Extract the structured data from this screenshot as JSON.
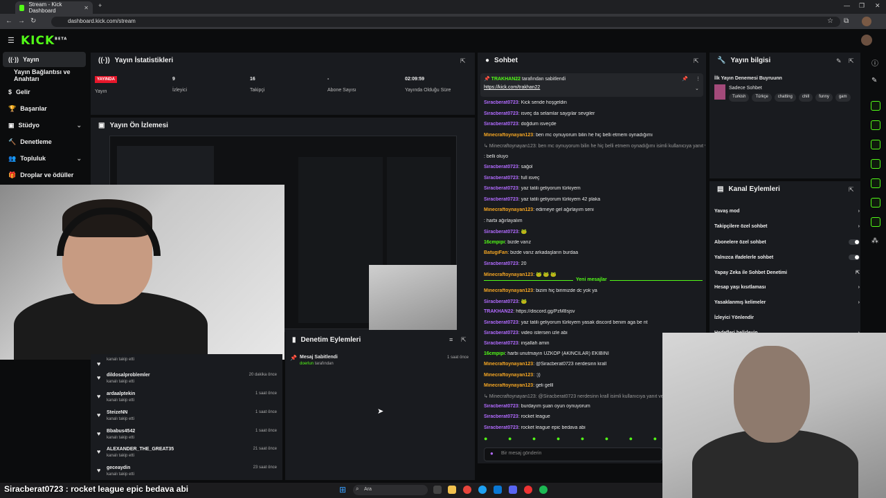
{
  "browser": {
    "tab_title": "Stream - Kick Dashboard",
    "url": "dashboard.kick.com/stream"
  },
  "header": {
    "logo": "KICK",
    "logo_badge": "BETA"
  },
  "sidebar": {
    "items": [
      {
        "label": "Yayın"
      },
      {
        "label": "Yayın Bağlantısı ve Anahtarı"
      },
      {
        "label": "Gelir"
      },
      {
        "label": "Başarılar"
      },
      {
        "label": "Stüdyo"
      },
      {
        "label": "Denetleme"
      },
      {
        "label": "Topluluk"
      },
      {
        "label": "Droplar ve ödüller"
      }
    ]
  },
  "stats": {
    "title": "Yayın İstatistikleri",
    "live_badge": "YAYINDA",
    "items": [
      {
        "value": "",
        "label": "Yayın"
      },
      {
        "value": "9",
        "label": "İzleyici"
      },
      {
        "value": "16",
        "label": "Takipçi"
      },
      {
        "value": "-",
        "label": "Abone Sayısı"
      },
      {
        "value": "02:09:59",
        "label": "Yayında Olduğu Süre"
      }
    ]
  },
  "preview": {
    "title": "Yayın Ön İzlemesi"
  },
  "followers": [
    {
      "name": "",
      "sub": "kanalı takip etti",
      "time": ""
    },
    {
      "name": "dildosalproblemler",
      "sub": "kanalı takip etti",
      "time": "20 dakika önce"
    },
    {
      "name": "ardaalptekin",
      "sub": "kanalı takip etti",
      "time": "1 saat önce"
    },
    {
      "name": "SteizeNN",
      "sub": "kanalı takip etti",
      "time": "1 saat önce"
    },
    {
      "name": "Bbabus4542",
      "sub": "kanalı takip etti",
      "time": "1 saat önce"
    },
    {
      "name": "ALEXANDER_THE_GREAT35",
      "sub": "kanalı takip etti",
      "time": "21 saat önce"
    },
    {
      "name": "geceaydin",
      "sub": "kanalı takip etti",
      "time": "23 saat önce"
    }
  ],
  "moderation": {
    "title": "Denetim Eylemleri",
    "entry_title": "Mesaj Sabitlendi",
    "entry_user": "doerlun",
    "entry_suffix": "tarafından",
    "entry_time": "1 saat önce"
  },
  "chat": {
    "title": "Sohbet",
    "pinned_by": "TRAKHAN22",
    "pinned_suffix": "tarafından sabitlendi",
    "pinned_link": "https://kick.com/trakhan22",
    "new_messages": "Yeni mesajlar",
    "input_placeholder": "Bir mesaj gönderin",
    "messages": [
      {
        "user": "Siracberat0723",
        "text": ": Kick sende hoşgeldin",
        "c": "u1"
      },
      {
        "user": "Siracberat0723",
        "text": ": isveç da selamlar saygılar sevgiler",
        "c": "u1"
      },
      {
        "user": "Siracberat0723",
        "text": ": doğdum isveçde",
        "c": "u1"
      },
      {
        "user": "Minecraftoynayan123",
        "text": ": ben mc oynuyorum bilin he hiç belli etmem oynadığımı",
        "c": "u2"
      },
      {
        "user": "",
        "text": "↳ Minecraftoynayan123: ben mc oynuyorum bilin he hiç belli etmem oynadığımı isimli kullanıcıya yanıt verir",
        "c": "u1"
      },
      {
        "user": "",
        "text": ": belli oluyo",
        "c": "u4"
      },
      {
        "user": "Siracberat0723",
        "text": ": sağol",
        "c": "u1"
      },
      {
        "user": "Siracberat0723",
        "text": ": full isveç",
        "c": "u1"
      },
      {
        "user": "Siracberat0723",
        "text": ": yaz tatili geliyorum türkiyem",
        "c": "u1"
      },
      {
        "user": "Siracberat0723",
        "text": ": yaz tatili geliyorum türkiyem 42 plaka",
        "c": "u1"
      },
      {
        "user": "Minecraftoynayan123",
        "text": ": edirneye gel ağırlayım seni",
        "c": "u2"
      },
      {
        "user": "",
        "text": ": harbi ağırlayalım",
        "c": "u4"
      },
      {
        "user": "Siracberat0723",
        "text": ": 🐸",
        "c": "u1"
      },
      {
        "user": "16cmpipi",
        "text": ": bizde varız",
        "c": "u3"
      },
      {
        "user": "BatugiFan",
        "text": ": bizde varız arkadaşların burdaa",
        "c": "u2"
      },
      {
        "user": "Siracberat0723",
        "text": ": 20",
        "c": "u1"
      },
      {
        "user": "Minecraftoynayan123",
        "text": ": 🐸 🐸 🐸",
        "c": "u2"
      }
    ],
    "messages_after": [
      {
        "user": "Minecraftoynayan123",
        "text": ": bizim hiç birimizde dc yok ya",
        "c": "u2"
      },
      {
        "user": "Siracberat0723",
        "text": ": 🐸",
        "c": "u1"
      },
      {
        "user": "TRAKHAN22",
        "text": ": https://discord.gg/PzM8sjsv",
        "c": "u1"
      },
      {
        "user": "Siracberat0723",
        "text": ": yaz tatili geliyorum türkiyem yasak discord benim aga be nt",
        "c": "u1"
      },
      {
        "user": "Siracberat0723",
        "text": ": video istersen izle abi",
        "c": "u1"
      },
      {
        "user": "Siracberat0723",
        "text": ": inşallah amin",
        "c": "u1"
      },
      {
        "user": "16cmpipi",
        "text": ": harbi unutmayın UZKÖP (AKINCILAR) EKİBİNİ",
        "c": "u3"
      },
      {
        "user": "Minecraftoynayan123",
        "text": ": @Siracberat0723 nerdesinn krall",
        "c": "u2"
      },
      {
        "user": "Minecraftoynayan123",
        "text": ": :))",
        "c": "u2"
      },
      {
        "user": "Minecraftoynayan123",
        "text": ": geli gelll",
        "c": "u2"
      },
      {
        "user": "",
        "text": "↳ Minecraftoynayan123: @Siracberat0723 nerdesinn krall isimli kullanıcıya yanıt veriyor",
        "c": "u1"
      },
      {
        "user": "Siracberat0723",
        "text": ": burdayım şuan oyun oynuyorum",
        "c": "u1"
      },
      {
        "user": "Siracberat0723",
        "text": ": rocket league",
        "c": "u1"
      },
      {
        "user": "Siracberat0723",
        "text": ": rocket league epic bedava abi",
        "c": "u1"
      }
    ]
  },
  "stream_info": {
    "title": "Yayın bilgisi",
    "stream_title": "İlk Yayın Denemesi Buyruunn",
    "category": "Sadece Sohbet",
    "tags": [
      "Turkish",
      "Türkçe",
      "chatting",
      "chill",
      "funny",
      "gam"
    ]
  },
  "channel_actions": {
    "title": "Kanal Eylemleri",
    "items": [
      {
        "label": "Yavaş mod",
        "kind": "arrow"
      },
      {
        "label": "Takipçilere özel sohbet",
        "kind": "arrow"
      },
      {
        "label": "Abonelere özel sohbet",
        "kind": "toggle"
      },
      {
        "label": "Yalnızca ifadelerle sohbet",
        "kind": "toggle"
      },
      {
        "label": "Yapay Zeka ile Sohbet Denetimi",
        "kind": "ext"
      },
      {
        "label": "Hesap yaşı kısıtlaması",
        "kind": "arrow"
      },
      {
        "label": "Yasaklanmış kelimeler",
        "kind": "arrow"
      },
      {
        "label": "İzleyici Yönlendir",
        "kind": "none"
      },
      {
        "label": "Hedefleri belirleyin",
        "kind": "arrow"
      }
    ]
  },
  "overlay": {
    "user": "Siracberat0723",
    "text": " : rocket league epic bedava abi"
  },
  "taskbar": {
    "search": "Ara"
  },
  "colors": {
    "brand": "#53fc18",
    "live": "#e8172b"
  }
}
